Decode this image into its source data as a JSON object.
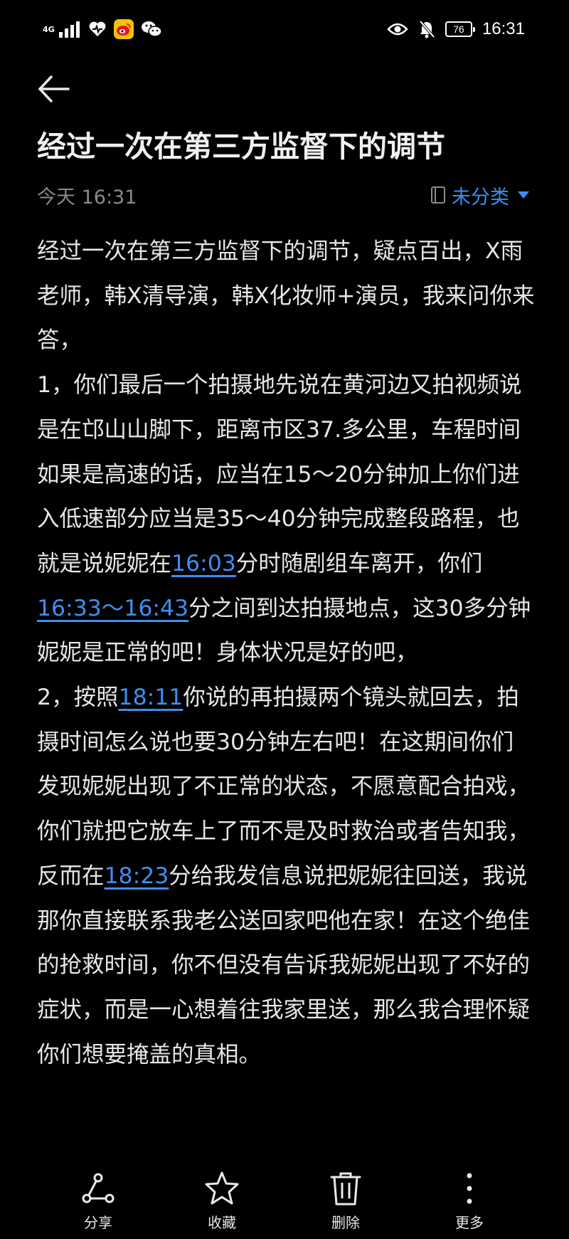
{
  "status_bar": {
    "network": "4G",
    "battery": "76",
    "time": "16:31"
  },
  "note": {
    "title": "经过一次在第三方监督下的调节",
    "timestamp": "今天 16:31",
    "category": "未分类",
    "paragraphs": [
      [
        {
          "text": "经过一次在第三方监督下的调节，疑点百出，X雨老师，韩X清导演，韩X化妆师+演员，我来问你来答，"
        }
      ],
      [
        {
          "text": "1，你们最后一个拍摄地先说在黄河边又拍视频说是在邙山山脚下，距离市区37.多公里，车程时间如果是高速的话，应当在15～20分钟加上你们进入低速部分应当是35～40分钟完成整段路程，也就是说妮妮在"
        },
        {
          "text": "16:03",
          "link": true
        },
        {
          "text": "分时随剧组车离开，你们"
        },
        {
          "text": "16:33～16:43",
          "link": true
        },
        {
          "text": "分之间到达拍摄地点，这30多分钟妮妮是正常的吧！身体状况是好的吧，"
        }
      ],
      [
        {
          "text": "2，按照"
        },
        {
          "text": "18:11",
          "link": true
        },
        {
          "text": "你说的再拍摄两个镜头就回去，拍摄时间怎么说也要30分钟左右吧！在这期间你们发现妮妮出现了不正常的状态，不愿意配合拍戏，你们就把它放车上了而不是及时救治或者告知我，反而在"
        },
        {
          "text": "18:23",
          "link": true
        },
        {
          "text": "分给我发信息说把妮妮往回送，我说那你直接联系我老公送回家吧他在家！在这个绝佳的抢救时间，你不但没有告诉我妮妮出现了不好的症状，而是一心想着往我家里送，那么我合理怀疑你们想要掩盖的真相。"
        }
      ]
    ]
  },
  "toolbar": {
    "share_label": "分享",
    "favorite_label": "收藏",
    "delete_label": "删除",
    "more_label": "更多"
  },
  "colors": {
    "background": "#000000",
    "accent": "#3d8ff0",
    "text": "#e6e6e6",
    "muted": "#8a8a8a"
  }
}
